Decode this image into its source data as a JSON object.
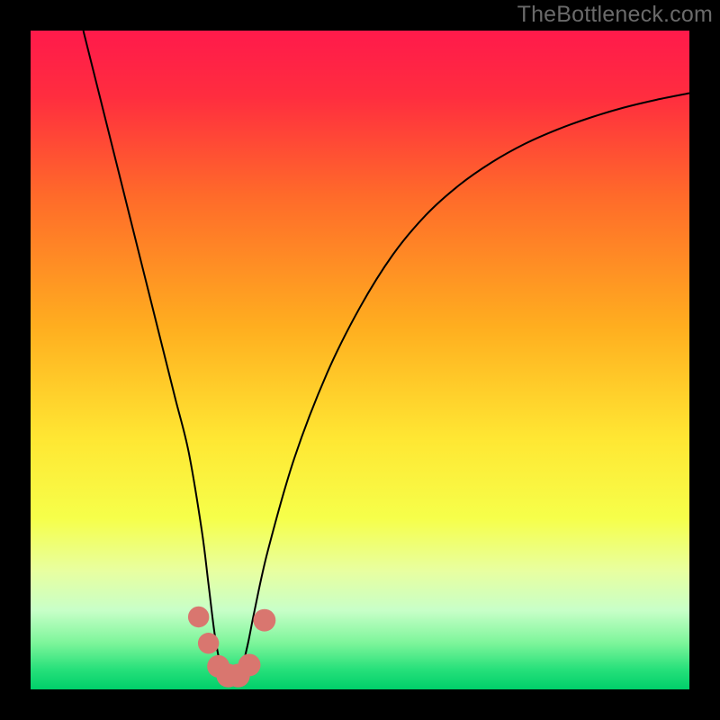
{
  "watermark_text": "TheBottleneck.com",
  "chart_data": {
    "type": "line",
    "title": "",
    "xlabel": "",
    "ylabel": "",
    "xlim": [
      0,
      100
    ],
    "ylim": [
      0,
      100
    ],
    "gradient_stops": [
      {
        "offset": 0,
        "color": "#ff1a4b"
      },
      {
        "offset": 10,
        "color": "#ff2d3f"
      },
      {
        "offset": 25,
        "color": "#ff6a2a"
      },
      {
        "offset": 45,
        "color": "#ffae1f"
      },
      {
        "offset": 62,
        "color": "#ffe733"
      },
      {
        "offset": 74,
        "color": "#f6ff4a"
      },
      {
        "offset": 82,
        "color": "#e8ffa0"
      },
      {
        "offset": 88,
        "color": "#c8ffc8"
      },
      {
        "offset": 93,
        "color": "#7cf59a"
      },
      {
        "offset": 97,
        "color": "#26e07a"
      },
      {
        "offset": 100,
        "color": "#00cf6a"
      }
    ],
    "series": [
      {
        "name": "bottleneck-curve",
        "x": [
          8,
          10,
          12,
          14,
          16,
          18,
          20,
          22,
          24,
          26,
          27,
          28,
          29,
          30,
          31,
          32,
          33,
          34,
          36,
          40,
          45,
          50,
          55,
          60,
          65,
          70,
          75,
          80,
          85,
          90,
          95,
          100
        ],
        "y": [
          100,
          92,
          84,
          76,
          68,
          60,
          52,
          44,
          36,
          24,
          16,
          8,
          3,
          1,
          1,
          3,
          7,
          12,
          21,
          35,
          48,
          58,
          66,
          72,
          76.5,
          80,
          82.8,
          85,
          86.8,
          88.3,
          89.5,
          90.5
        ]
      }
    ],
    "markers": [
      {
        "x": 25.5,
        "y": 11,
        "r": 1.6
      },
      {
        "x": 27.0,
        "y": 7,
        "r": 1.6
      },
      {
        "x": 28.5,
        "y": 3.5,
        "r": 1.7
      },
      {
        "x": 30.0,
        "y": 2.1,
        "r": 1.8
      },
      {
        "x": 31.5,
        "y": 2.1,
        "r": 1.8
      },
      {
        "x": 33.2,
        "y": 3.7,
        "r": 1.7
      },
      {
        "x": 35.5,
        "y": 10.5,
        "r": 1.7
      }
    ],
    "marker_color": "#d9766f",
    "curve_color": "#000000",
    "curve_width": 2.0
  }
}
